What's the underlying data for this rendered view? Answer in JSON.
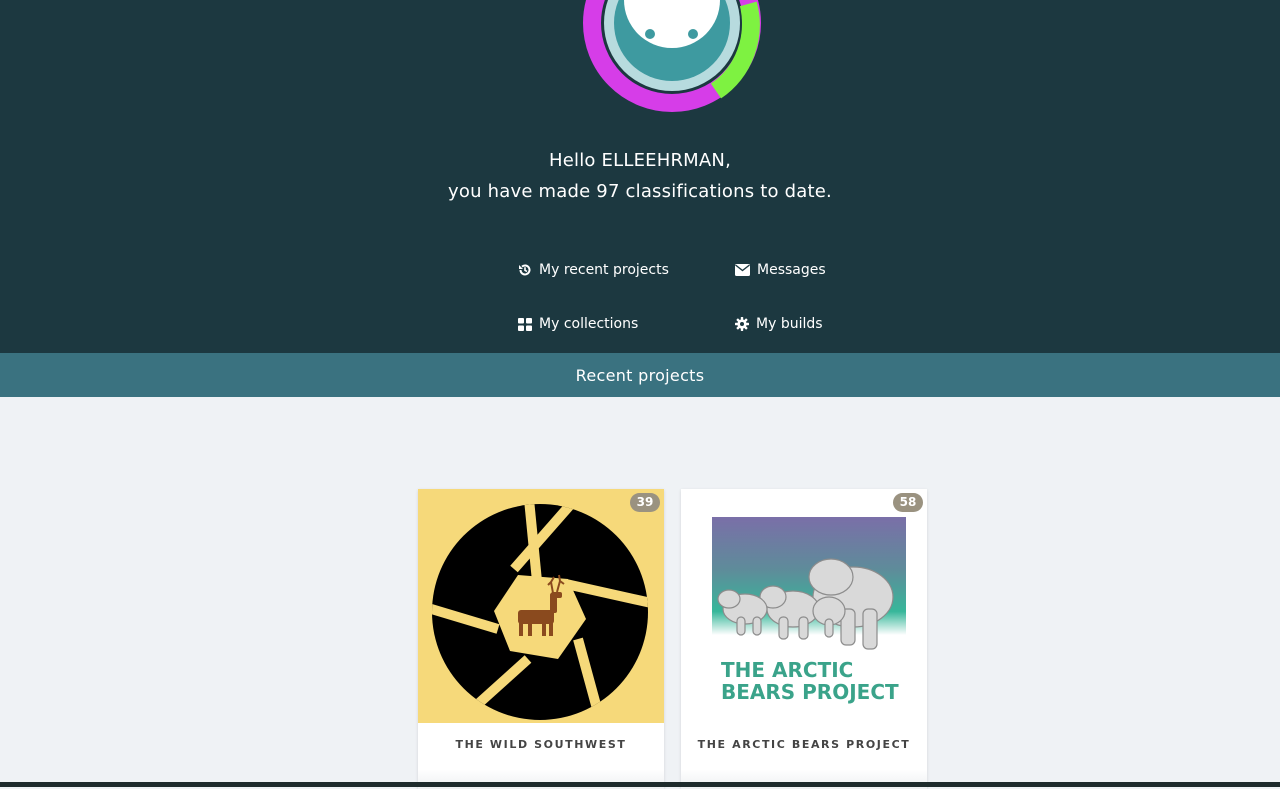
{
  "header": {
    "greeting_line1": "Hello ELLEEHRMAN,",
    "greeting_line2": "you have made 97 classifications to date."
  },
  "nav": {
    "recent_projects": "My recent projects",
    "messages": "Messages",
    "collections": "My collections",
    "builds": "My builds"
  },
  "section": {
    "title": "Recent projects"
  },
  "projects": [
    {
      "title": "THE WILD SOUTHWEST",
      "count": "39"
    },
    {
      "title": "THE ARCTIC BEARS PROJECT",
      "count": "58",
      "logo_text_line1": "THE ARCTIC",
      "logo_text_line2": "BEARS PROJECT"
    }
  ],
  "colors": {
    "hero_bg": "#1c3840",
    "band_bg": "#3a7280",
    "ring_magenta": "#d63de8",
    "ring_green": "#7ef241",
    "avatar_teal": "#3e9aa0",
    "wild_bg": "#f6d97a",
    "bears_text": "#3aa38a"
  },
  "icons": {
    "recent": "history-icon",
    "messages": "envelope-icon",
    "collections": "grid-icon",
    "builds": "gear-icon"
  }
}
